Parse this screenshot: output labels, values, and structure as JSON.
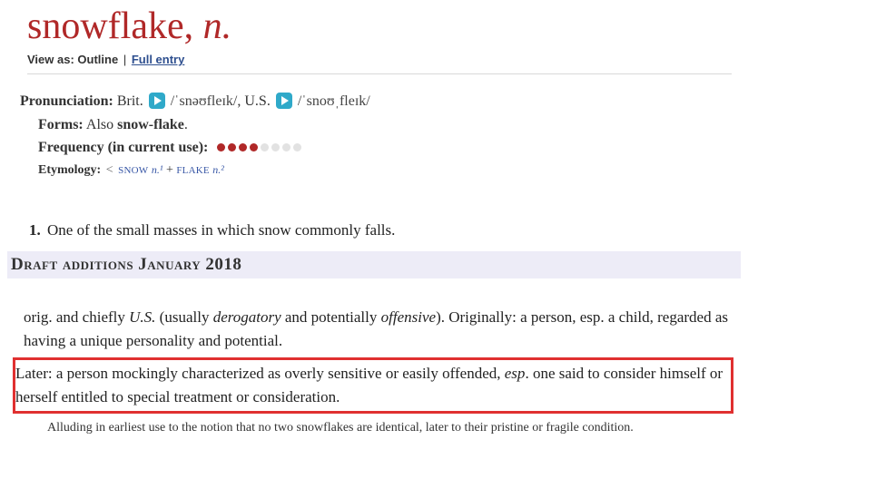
{
  "headword": {
    "word": "snowflake",
    "comma": ", ",
    "pos": "n."
  },
  "viewas": {
    "label": "View as:",
    "option_outline": "Outline",
    "pipe": "|",
    "option_full": "Full entry"
  },
  "pronunciation": {
    "label": "Pronunciation:",
    "brit_label": " Brit.",
    "brit_phon": "/ˈsnəʊfleɪk/",
    "sep": ",  ",
    "us_label": "U.S.",
    "us_phon": "/ˈsnoʊˌfleɪk/"
  },
  "forms": {
    "label": "Forms:",
    "prefix": " Also ",
    "value": "snow-flake",
    "suffix": "."
  },
  "frequency": {
    "label": "Frequency (in current use):",
    "filled": 4,
    "empty": 4
  },
  "etymology": {
    "label": "Etymology:",
    "angle": " < ",
    "w1": "snow",
    "p1": "n.¹",
    "plus": " + ",
    "w2": "flake",
    "p2": "n.²"
  },
  "sense1": {
    "num": "1.",
    "text": " One of the small masses in which snow commonly falls."
  },
  "draft_header": "Draft additions January 2018",
  "addition": {
    "origin": "orig. and chiefly ",
    "us": "U.S.",
    "paren_open": " (usually ",
    "derog": "derogatory",
    "mid": " and potentially ",
    "offensive": "offensive",
    "paren_close": "). Originally: a person, esp. a child, regarded as having a unique personality and potential.",
    "later_a": "Later: a person mockingly characterized as overly sensitive or easily offended, ",
    "later_esp": "esp",
    "later_b": ". one said to consider himself or herself entitled to special treatment or consideration."
  },
  "note": "Alluding in earliest use to the notion that no two snowflakes are identical, later to their pristine or fragile condition."
}
